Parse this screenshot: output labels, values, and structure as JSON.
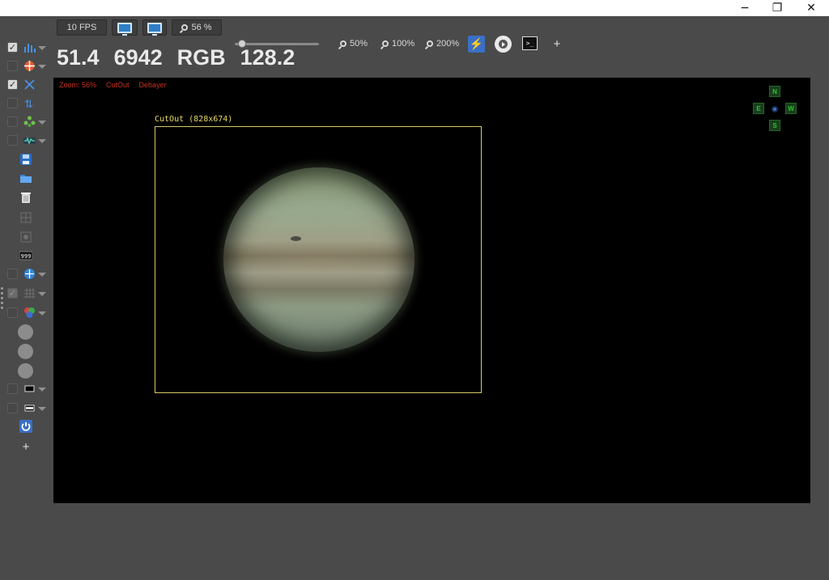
{
  "titlebar": {
    "minimize_icon": "−",
    "restore_icon": "❐",
    "close_icon": "✕"
  },
  "toolbar": {
    "fps_label": "10 FPS",
    "zoom_label": "56 %",
    "zoom_50_label": "50%",
    "zoom_100_label": "100%",
    "zoom_200_label": "200%",
    "slider_value_percent": 56,
    "terminal_icon_glyph": ">_",
    "add_label": "+"
  },
  "stats": {
    "value1": "51.4",
    "value2": "6942",
    "value3": "RGB",
    "value4": "128.2"
  },
  "viewer": {
    "overlay_items": [
      "Zoom: 56%",
      "CutOut",
      "Debayer"
    ],
    "cutout_label": "CutOut (828x674)"
  },
  "compass": {
    "north": "N",
    "south": "S",
    "east": "E",
    "west": "W"
  },
  "sidebar": {
    "counter_label": "999",
    "add_label": "+"
  },
  "colors": {
    "overlay_text": "#c8321f",
    "cutout_border": "#d6c967",
    "accent_blue": "#3a6fc5",
    "compass_green": "#31bf37"
  }
}
